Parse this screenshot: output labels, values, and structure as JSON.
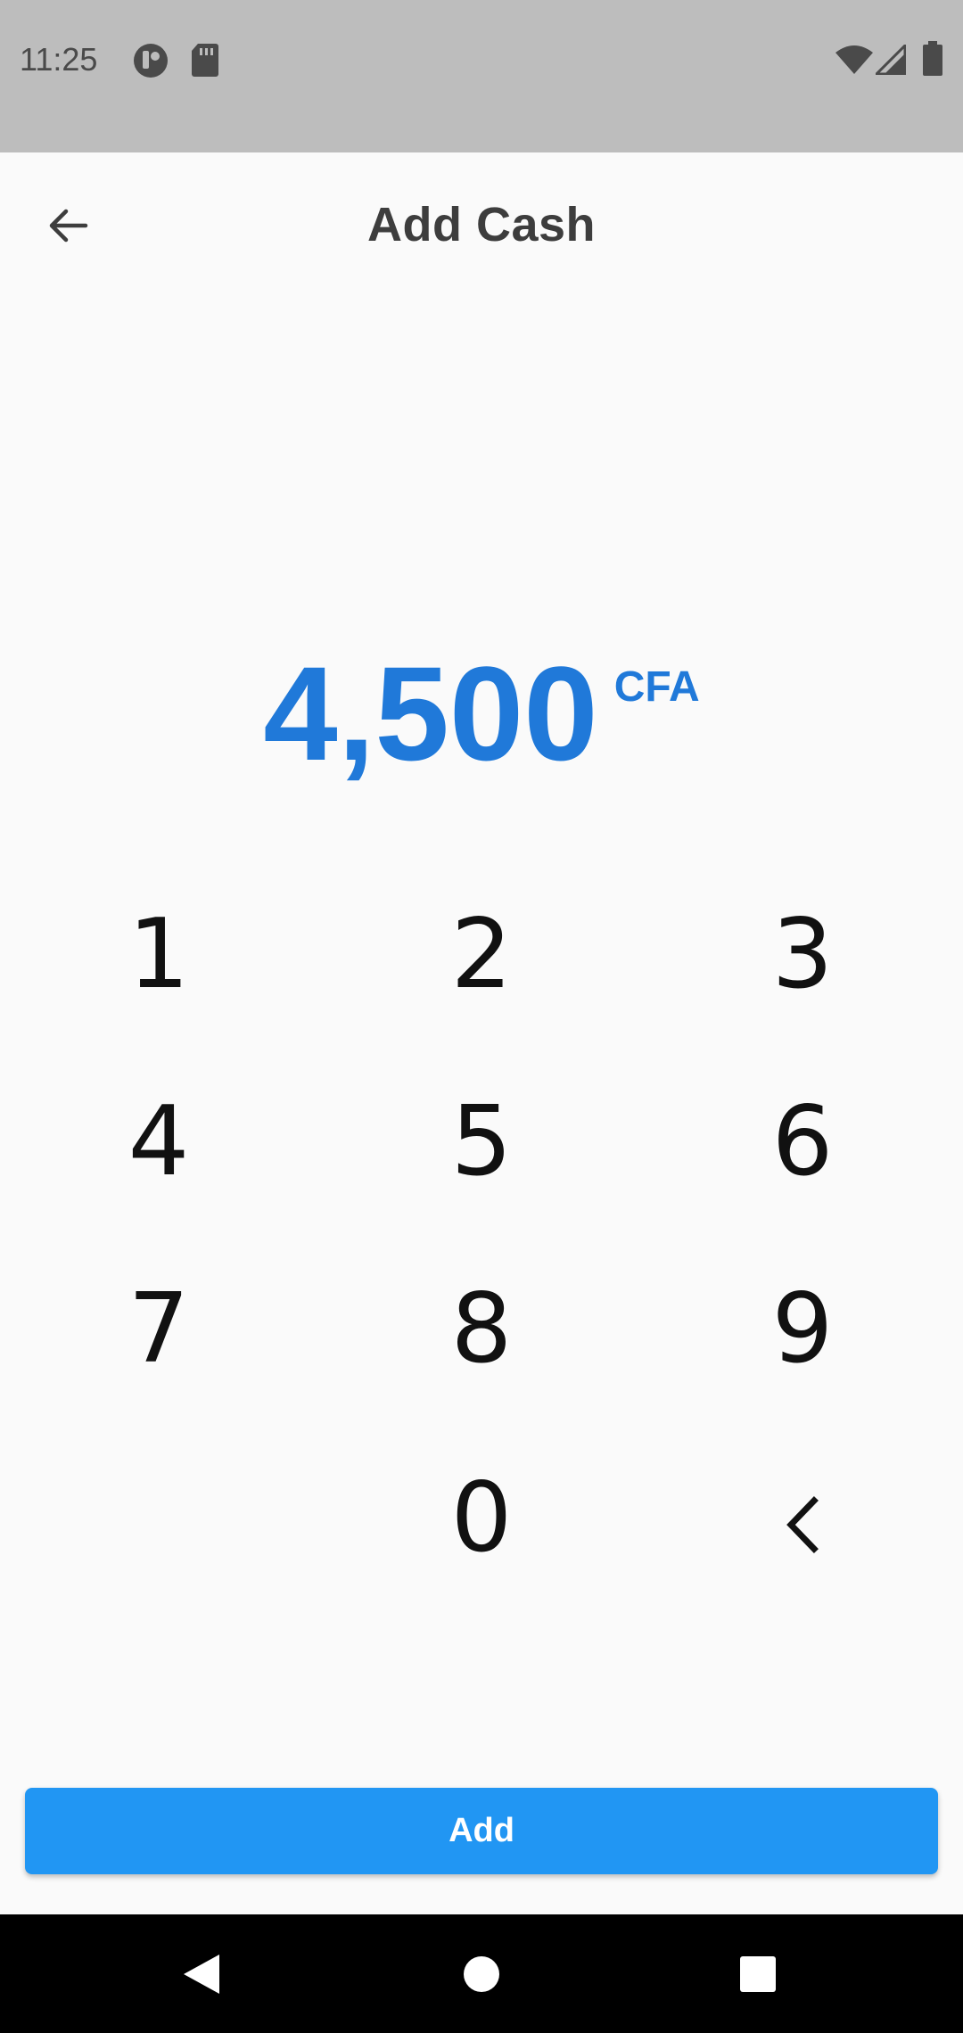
{
  "status_bar": {
    "time": "11:25",
    "icons": [
      "media-icon",
      "sd-card-icon",
      "wifi-icon",
      "signal-icon",
      "battery-icon"
    ]
  },
  "app_bar": {
    "title": "Add Cash",
    "back_icon": "arrow-left-icon"
  },
  "amount": {
    "value": "4,500",
    "currency": "CFA",
    "color": "#2079d9"
  },
  "keypad": {
    "keys": [
      "1",
      "2",
      "3",
      "4",
      "5",
      "6",
      "7",
      "8",
      "9",
      "0"
    ],
    "backspace_icon": "chevron-left-icon"
  },
  "add_button": {
    "label": "Add",
    "color": "#2196f3"
  },
  "nav_bar": {
    "icons": [
      "back-triangle-icon",
      "home-circle-icon",
      "recents-square-icon"
    ]
  }
}
